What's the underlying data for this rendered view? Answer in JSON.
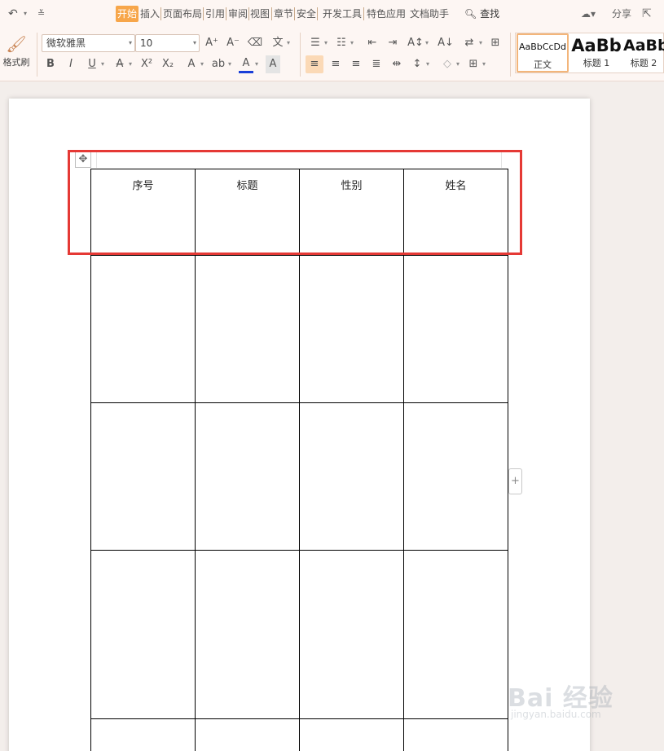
{
  "menubar": {
    "tabs": [
      "开始",
      "插入",
      "页面布局",
      "引用",
      "审阅",
      "视图",
      "章节",
      "安全",
      "开发工具",
      "特色应用",
      "文档助手"
    ],
    "active_tab": "开始",
    "search_label": "查找",
    "share_label": "分享"
  },
  "ribbon": {
    "format_painter_label": "格式刷",
    "font_name": "微软雅黑",
    "font_size": "10",
    "styles": [
      {
        "preview": "AaBbCcDd",
        "name": "正文"
      },
      {
        "preview": "AaBb",
        "name": "标题 1"
      },
      {
        "preview": "AaBb",
        "name": "标题 2"
      }
    ]
  },
  "document": {
    "table_headers": [
      "序号",
      "标题",
      "性别",
      "姓名"
    ]
  },
  "watermark": {
    "main": "Bai 经验",
    "sub": "jingyan.baidu.com"
  },
  "colors": {
    "accent_tab": "#f7a64a",
    "highlight_box": "#e53935",
    "ribbon_bg": "#fdf6f3"
  }
}
